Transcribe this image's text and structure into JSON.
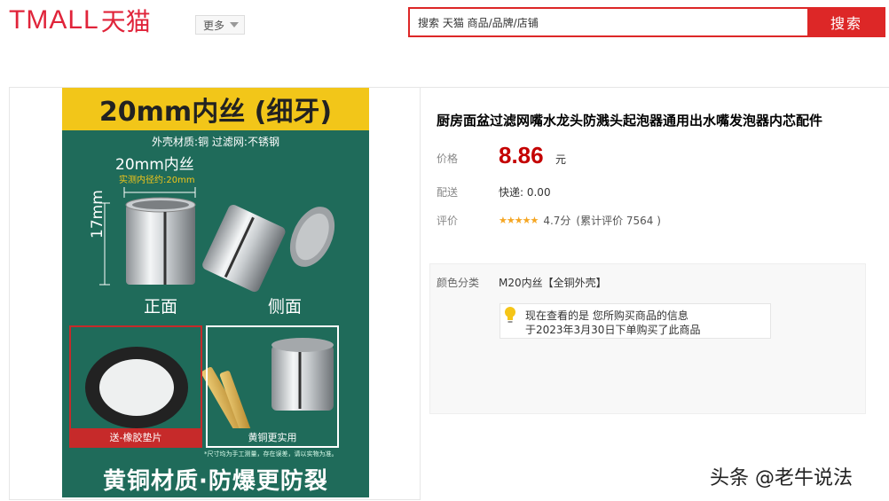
{
  "header": {
    "logo_latin": "TMALL",
    "logo_cn": "天猫",
    "more_label": "更多",
    "search_placeholder": "搜索 天猫 商品/品牌/店铺",
    "search_button": "搜索"
  },
  "image": {
    "banner_top": "20mm内丝 (细牙)",
    "material": "外壳材质:铜   过滤网:不锈钢",
    "dim_inner": "20mm内丝",
    "dim_measure": "实测内径约:20mm",
    "dim_height": "17mm",
    "label_front": "正面",
    "label_side": "侧面",
    "card_left_tag": "送-橡胶垫片",
    "card_right_tag": "黄铜更实用",
    "note": "*尺寸均为手工测量，存在误差，请以实物为准。",
    "banner_bottom": "黄铜材质·防爆更防裂",
    "colors": {
      "teal": "#1f6b5a",
      "yellow": "#f2c619",
      "red": "#c62a2a"
    }
  },
  "product": {
    "title": "厨房面盆过滤网嘴水龙头防溅头起泡器通用出水嘴发泡器内芯配件",
    "price_label": "价格",
    "price_value": "8.86",
    "price_unit": "元",
    "shipping_label": "配送",
    "shipping_value": "快递:  0.00",
    "rating_label": "评价",
    "rating_stars": "★★★★★",
    "rating_score": "4.7分",
    "rating_count": "(累计评价 7564 )",
    "sku_label": "颜色分类",
    "sku_value": "M20内丝【全铜外壳】",
    "tip_line1": "现在查看的是 您所购买商品的信息",
    "tip_line2": "于2023年3月30日下单购买了此商品",
    "accent": "#c40000"
  },
  "watermark": "头条 @老牛说法"
}
